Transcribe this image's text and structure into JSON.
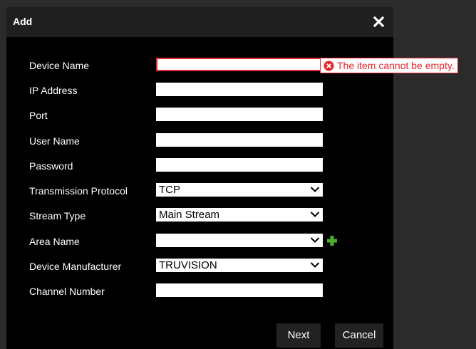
{
  "dialog": {
    "title": "Add"
  },
  "form": {
    "device_name": {
      "label": "Device Name",
      "value": ""
    },
    "ip_address": {
      "label": "IP Address",
      "value": ""
    },
    "port": {
      "label": "Port",
      "value": ""
    },
    "user_name": {
      "label": "User Name",
      "value": ""
    },
    "password": {
      "label": "Password",
      "value": ""
    },
    "transmission_protocol": {
      "label": "Transmission Protocol",
      "value": "TCP"
    },
    "stream_type": {
      "label": "Stream Type",
      "value": "Main Stream"
    },
    "area_name": {
      "label": "Area Name",
      "value": ""
    },
    "device_manufacturer": {
      "label": "Device Manufacturer",
      "value": "TRUVISION"
    },
    "channel_number": {
      "label": "Channel Number",
      "value": ""
    }
  },
  "validation": {
    "device_name_error": "The item cannot be empty."
  },
  "buttons": {
    "next": "Next",
    "cancel": "Cancel"
  },
  "colors": {
    "error": "#e8242b",
    "add_icon": "#4caf2a"
  },
  "icons": {
    "close": "close-icon",
    "error": "error-circle-icon",
    "add": "plus-icon",
    "dropdown": "chevron-down-icon"
  }
}
